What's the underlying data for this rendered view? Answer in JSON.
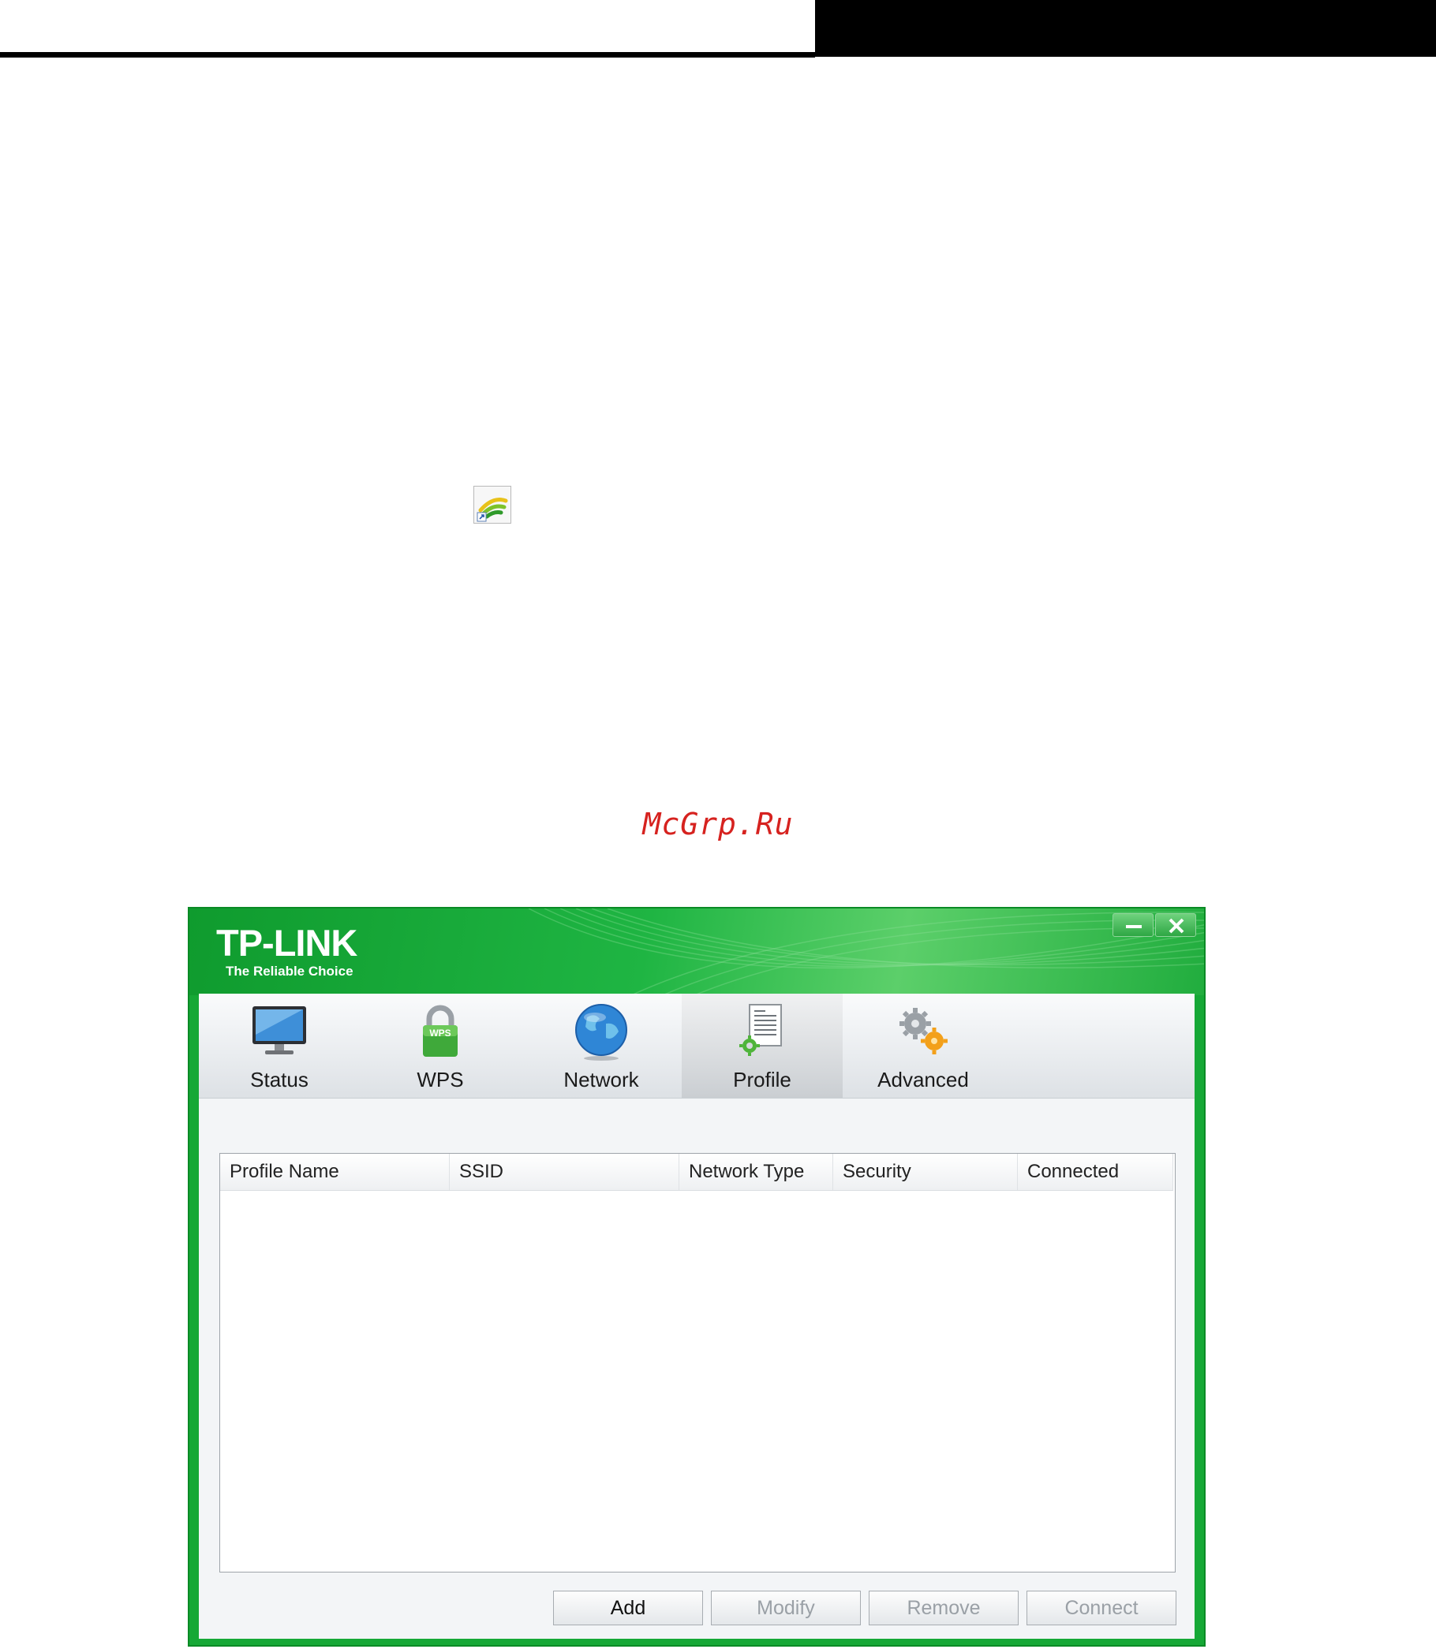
{
  "watermark": "McGrp.Ru",
  "app": {
    "brand": {
      "name": "TP-LINK",
      "tagline": "The Reliable Choice"
    },
    "tabs": [
      {
        "label": "Status",
        "icon": "monitor-icon",
        "active": false
      },
      {
        "label": "WPS",
        "icon": "wps-lock-icon",
        "active": false
      },
      {
        "label": "Network",
        "icon": "globe-icon",
        "active": false
      },
      {
        "label": "Profile",
        "icon": "profile-document-icon",
        "active": true
      },
      {
        "label": "Advanced",
        "icon": "gears-icon",
        "active": false
      }
    ],
    "table": {
      "columns": [
        "Profile Name",
        "SSID",
        "Network Type",
        "Security",
        "Connected"
      ],
      "rows": []
    },
    "buttons": {
      "add": "Add",
      "modify": "Modify",
      "remove": "Remove",
      "connect": "Connect"
    },
    "colors": {
      "brand_green": "#16a836",
      "accent_orange": "#f3a01a"
    }
  }
}
